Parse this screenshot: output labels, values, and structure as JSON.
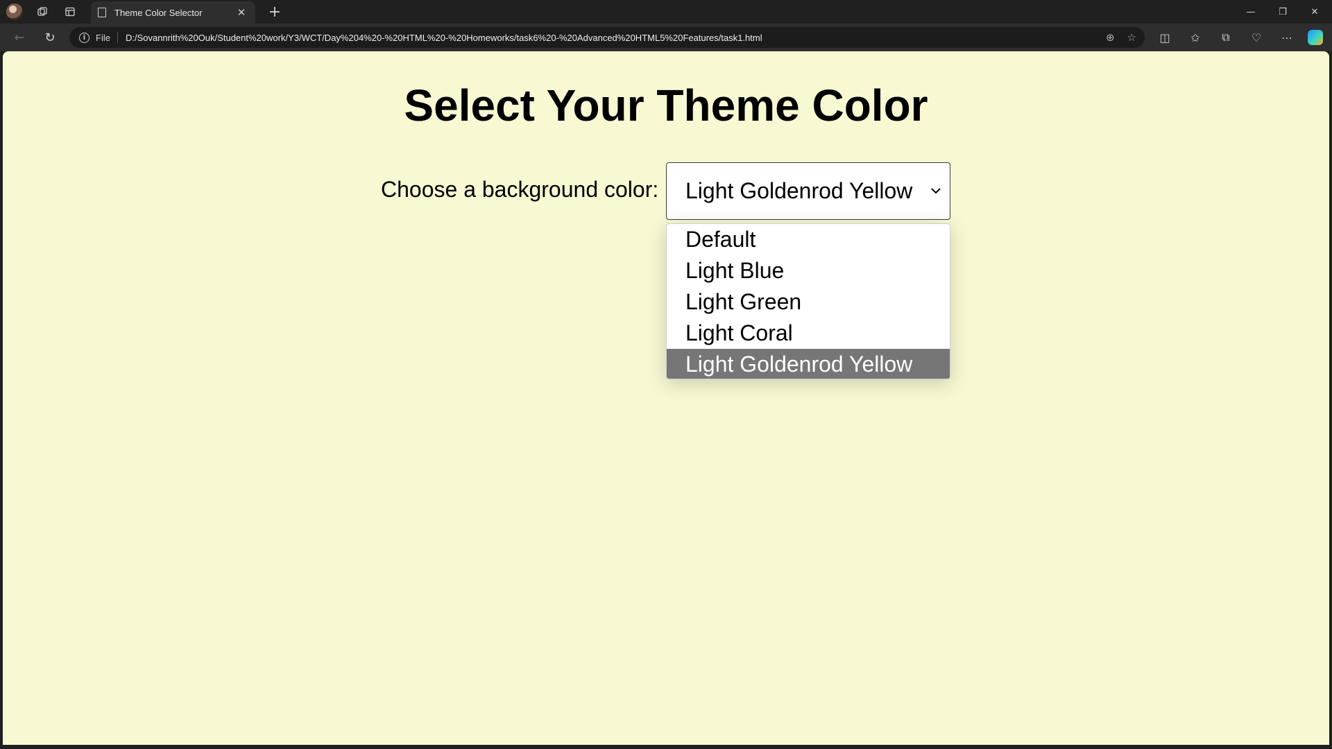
{
  "browser": {
    "tab_title": "Theme Color Selector",
    "address_scheme": "File",
    "url": "D:/Sovannrith%20Ouk/Student%20work/Y3/WCT/Day%204%20-%20HTML%20-%20Homeworks/task6%20-%20Advanced%20HTML5%20Features/task1.html",
    "icons": {
      "workspaces": "workspaces-icon",
      "tab_actions": "tab-actions-icon",
      "new_tab": "plus-icon",
      "back": "back-arrow-icon",
      "refresh": "refresh-icon",
      "info": "info-icon",
      "zoom": "zoom-icon",
      "favorite": "star-icon",
      "split": "split-screen-icon",
      "favorites": "favorites-icon",
      "collections": "collections-icon",
      "performance": "heart-pulse-icon",
      "more": "more-icon",
      "copilot": "copilot-icon"
    }
  },
  "page": {
    "heading": "Select Your Theme Color",
    "select_label": "Choose a background color:",
    "selected_value": "Light Goldenrod Yellow",
    "background_color": "#f8f8d2",
    "options": [
      {
        "label": "Default",
        "selected": false
      },
      {
        "label": "Light Blue",
        "selected": false
      },
      {
        "label": "Light Green",
        "selected": false
      },
      {
        "label": "Light Coral",
        "selected": false
      },
      {
        "label": "Light Goldenrod Yellow",
        "selected": true
      }
    ]
  }
}
